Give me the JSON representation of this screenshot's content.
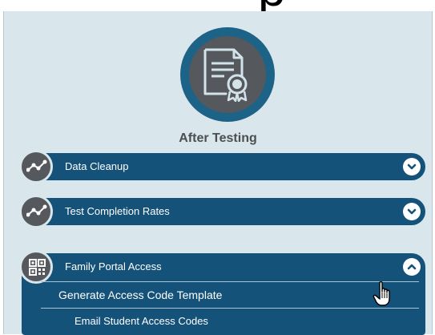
{
  "header": {
    "title_fragment": "p"
  },
  "phase": {
    "title": "After Testing",
    "icon": "certificate-document-icon"
  },
  "accordion": {
    "items": [
      {
        "label": "Data Cleanup",
        "icon": "line-chart-icon",
        "state": "collapsed",
        "toggle_icon": "chevron-down-icon"
      },
      {
        "label": "Test Completion Rates",
        "icon": "line-chart-icon",
        "state": "collapsed",
        "toggle_icon": "chevron-down-icon"
      },
      {
        "label": "Family Portal Access",
        "icon": "qr-code-icon",
        "state": "expanded",
        "toggle_icon": "chevron-up-icon",
        "subitems": [
          {
            "label": "Generate Access Code Template"
          },
          {
            "label": "Email Student Access Codes"
          }
        ]
      }
    ]
  },
  "colors": {
    "panel_background": "#d9e6ec",
    "bar": "#14527a",
    "badge_ring": "#1d6287",
    "badge_fill": "#55585d",
    "badge_icon": "#d3e3ea",
    "text_title": "#4b4f52",
    "text_bar": "#ffffff"
  },
  "cursor": {
    "type": "hand-pointer-icon"
  }
}
